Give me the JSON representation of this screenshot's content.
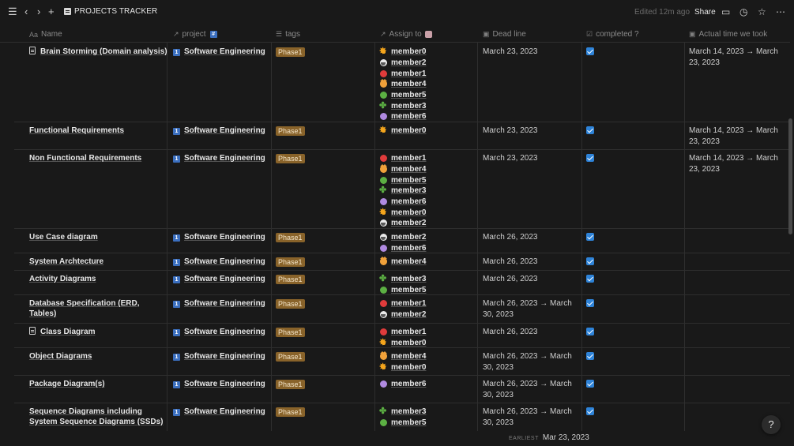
{
  "topbar": {
    "title": "PROJECTS TRACKER",
    "edited": "Edited 12m ago",
    "share": "Share"
  },
  "columns": {
    "name": "Name",
    "project": "project",
    "tags": "tags",
    "assign": "Assign to",
    "deadline": "Dead line",
    "completed": "completed ?",
    "actual": "Actual time we took"
  },
  "rows": [
    {
      "name": "Brain Storming (Domain analysis)",
      "page_icon": true,
      "project": "Software Engineering",
      "tag": "Phase1",
      "members": [
        {
          "name": "member0",
          "icon": "sun"
        },
        {
          "name": "member2",
          "icon": "bird"
        },
        {
          "name": "member1",
          "icon": "red"
        },
        {
          "name": "member4",
          "icon": "cat"
        },
        {
          "name": "member5",
          "icon": "green"
        },
        {
          "name": "member3",
          "icon": "clover"
        },
        {
          "name": "member6",
          "icon": "purple"
        }
      ],
      "deadline": "March 23, 2023",
      "completed": true,
      "actual": "March 14, 2023 → March 23, 2023"
    },
    {
      "name": "Functional Requirements",
      "page_icon": false,
      "project": "Software Engineering",
      "tag": "Phase1",
      "members": [
        {
          "name": "member0",
          "icon": "sun"
        }
      ],
      "deadline": "March 23, 2023",
      "completed": true,
      "actual": "March 14, 2023 → March 23, 2023"
    },
    {
      "name": "Non Functional Requirements",
      "page_icon": false,
      "project": "Software Engineering",
      "tag": "Phase1",
      "members": [
        {
          "name": "member1",
          "icon": "red"
        },
        {
          "name": "member4",
          "icon": "cat"
        },
        {
          "name": "member5",
          "icon": "green"
        },
        {
          "name": "member3",
          "icon": "clover"
        },
        {
          "name": "member6",
          "icon": "purple"
        },
        {
          "name": "member0",
          "icon": "sun"
        },
        {
          "name": "member2",
          "icon": "bird"
        }
      ],
      "deadline": "March 23, 2023",
      "completed": true,
      "actual": "March 14, 2023 → March 23, 2023"
    },
    {
      "name": "Use Case diagram",
      "page_icon": false,
      "project": "Software Engineering",
      "tag": "Phase1",
      "members": [
        {
          "name": "member2",
          "icon": "bird"
        },
        {
          "name": "member6",
          "icon": "purple"
        }
      ],
      "deadline": "March 26, 2023",
      "completed": true,
      "actual": ""
    },
    {
      "name": "System Archtecture",
      "page_icon": false,
      "project": "Software Engineering",
      "tag": "Phase1",
      "members": [
        {
          "name": "member4",
          "icon": "cat"
        }
      ],
      "deadline": "March 26, 2023",
      "completed": true,
      "actual": ""
    },
    {
      "name": "Activity Diagrams",
      "page_icon": false,
      "project": "Software Engineering",
      "tag": "Phase1",
      "members": [
        {
          "name": "member3",
          "icon": "clover"
        },
        {
          "name": "member5",
          "icon": "green"
        }
      ],
      "deadline": "March 26, 2023",
      "completed": true,
      "actual": ""
    },
    {
      "name": "Database Specification (ERD, Tables)",
      "page_icon": false,
      "project": "Software Engineering",
      "tag": "Phase1",
      "members": [
        {
          "name": "member1",
          "icon": "red"
        },
        {
          "name": "member2",
          "icon": "bird"
        }
      ],
      "deadline": "March 26, 2023 → March 30, 2023",
      "completed": true,
      "actual": ""
    },
    {
      "name": "Class Diagram",
      "page_icon": true,
      "project": "Software Engineering",
      "tag": "Phase1",
      "members": [
        {
          "name": "member1",
          "icon": "red"
        },
        {
          "name": "member0",
          "icon": "sun"
        }
      ],
      "deadline": "March 26, 2023",
      "completed": true,
      "actual": ""
    },
    {
      "name": "Object Diagrams",
      "page_icon": false,
      "project": "Software Engineering",
      "tag": "Phase1",
      "members": [
        {
          "name": "member4",
          "icon": "cat"
        },
        {
          "name": "member0",
          "icon": "sun"
        }
      ],
      "deadline": "March 26, 2023 → March 30, 2023",
      "completed": true,
      "actual": ""
    },
    {
      "name": "Package Diagram(s)",
      "page_icon": false,
      "project": "Software Engineering",
      "tag": "Phase1",
      "members": [
        {
          "name": "member6",
          "icon": "purple"
        }
      ],
      "deadline": "March 26, 2023 → March 30, 2023",
      "completed": true,
      "actual": ""
    },
    {
      "name": "Sequence Diagrams including System Sequence Diagrams (SSDs)",
      "page_icon": false,
      "project": "Software Engineering",
      "tag": "Phase1",
      "members": [
        {
          "name": "member3",
          "icon": "clover"
        },
        {
          "name": "member5",
          "icon": "green"
        }
      ],
      "deadline": "March 26, 2023 → March 30, 2023",
      "completed": true,
      "actual": ""
    }
  ],
  "footer": {
    "label": "EARLIEST",
    "value": "Mar 23, 2023"
  },
  "help": "?",
  "colors": {
    "background": "#191919",
    "tag": "#89632a",
    "checkbox": "#2e83d8"
  }
}
